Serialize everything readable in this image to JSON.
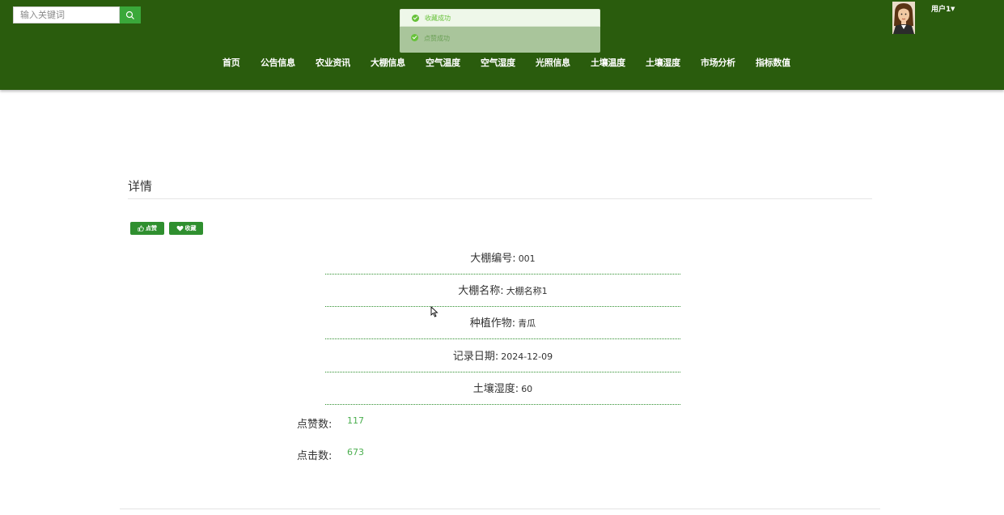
{
  "search": {
    "placeholder": "输入关键词"
  },
  "nav": {
    "items": [
      {
        "label": "首页"
      },
      {
        "label": "公告信息"
      },
      {
        "label": "农业资讯"
      },
      {
        "label": "大棚信息"
      },
      {
        "label": "空气温度"
      },
      {
        "label": "空气湿度"
      },
      {
        "label": "光照信息"
      },
      {
        "label": "土壤温度"
      },
      {
        "label": "土壤湿度"
      },
      {
        "label": "市场分析"
      },
      {
        "label": "指标数值"
      }
    ]
  },
  "toasts": [
    {
      "text": "收藏成功",
      "icon": "check-circle-icon"
    },
    {
      "text": "点赞成功",
      "icon": "check-circle-icon"
    }
  ],
  "user": {
    "name": "用户1"
  },
  "detail": {
    "title": "详情",
    "like_label": "点赞",
    "favorite_label": "收藏",
    "fields": [
      {
        "label": "大棚编号:",
        "value": "001"
      },
      {
        "label": "大棚名称:",
        "value": "大棚名称1"
      },
      {
        "label": "种植作物:",
        "value": "青瓜"
      },
      {
        "label": "记录日期:",
        "value": "2024-12-09"
      },
      {
        "label": "土壤湿度:",
        "value": "60"
      }
    ],
    "stats": [
      {
        "label": "点赞数:",
        "value": "117"
      },
      {
        "label": "点击数:",
        "value": "673"
      }
    ]
  },
  "colors": {
    "header_bg": "#2a5c0d",
    "accent": "#2f8f2f",
    "search_button": "#3aa83a",
    "stat_value": "#4caf50",
    "toast_success": "#67c23a"
  }
}
